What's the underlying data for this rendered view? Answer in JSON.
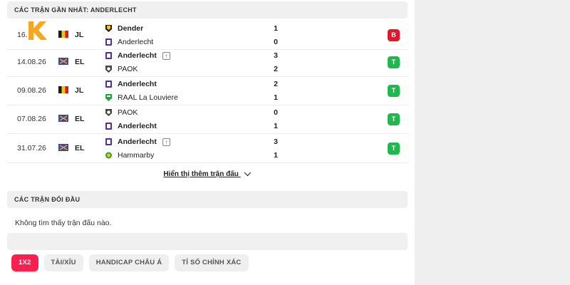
{
  "recent_header": "CÁC TRẬN GẦN NHẤT: ANDERLECHT",
  "matches": [
    {
      "date": "16.",
      "competition": "JL",
      "home": "Dender",
      "away": "Anderlecht",
      "home_score": "1",
      "away_score": "0",
      "result": "B",
      "result_type": "loss"
    },
    {
      "date": "14.08.26",
      "competition": "EL",
      "home": "Anderlecht",
      "away": "PAOK",
      "home_score": "3",
      "away_score": "2",
      "result": "T",
      "result_type": "win"
    },
    {
      "date": "09.08.26",
      "competition": "JL",
      "home": "Anderlecht",
      "away": "RAAL La Louviere",
      "home_score": "2",
      "away_score": "1",
      "result": "T",
      "result_type": "win"
    },
    {
      "date": "07.08.26",
      "competition": "EL",
      "home": "PAOK",
      "away": "Anderlecht",
      "home_score": "0",
      "away_score": "1",
      "result": "T",
      "result_type": "win"
    },
    {
      "date": "31.07.26",
      "competition": "EL",
      "home": "Anderlecht",
      "away": "Hammarby",
      "home_score": "3",
      "away_score": "1",
      "result": "T",
      "result_type": "win"
    }
  ],
  "show_more": "Hiển thị thêm trận đấu",
  "h2h_header": "CÁC TRẬN ĐỐI ĐẦU",
  "h2h_empty": "Không tìm thấy trận đấu nào.",
  "tabs": [
    "1X2",
    "TÀI/XỈU",
    "HANDICAP CHÂU Á",
    "TỈ SỐ CHÍNH XÁC"
  ],
  "colors": {
    "accent": "#ff1f4f",
    "win": "#1eb84c",
    "loss": "#e2182a",
    "logo": "#f5a623"
  },
  "icons": {
    "chevron": "chevron-down-icon",
    "promoted": "arrow-up-box-icon",
    "logo": "k-logo-icon"
  }
}
